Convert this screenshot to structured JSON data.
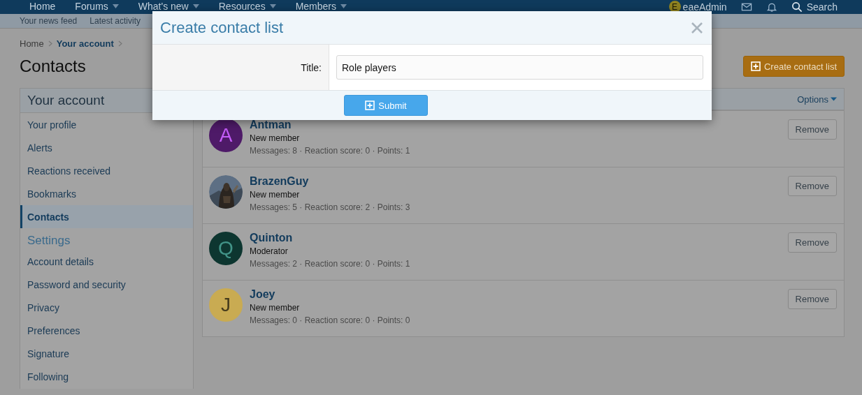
{
  "nav": {
    "items": [
      {
        "label": "Home",
        "dropdown": false
      },
      {
        "label": "Forums",
        "dropdown": true
      },
      {
        "label": "What's new",
        "dropdown": true
      },
      {
        "label": "Resources",
        "dropdown": true
      },
      {
        "label": "Members",
        "dropdown": true
      }
    ],
    "user": {
      "initial": "E",
      "name": "eaeAdmin"
    },
    "search": "Search"
  },
  "subnav": [
    "Your news feed",
    "Latest activity"
  ],
  "breadcrumb": [
    {
      "label": "Home",
      "current": false
    },
    {
      "label": "Your account",
      "current": true
    }
  ],
  "page_title": "Contacts",
  "create_button": "Create contact list",
  "sidebar": {
    "sections": [
      {
        "title": "Your account",
        "items": [
          {
            "label": "Your profile",
            "selected": false
          },
          {
            "label": "Alerts",
            "selected": false
          },
          {
            "label": "Reactions received",
            "selected": false
          },
          {
            "label": "Bookmarks",
            "selected": false
          },
          {
            "label": "Contacts",
            "selected": true
          }
        ]
      },
      {
        "title": "Settings",
        "items": [
          {
            "label": "Account details",
            "selected": false
          },
          {
            "label": "Password and security",
            "selected": false
          },
          {
            "label": "Privacy",
            "selected": false
          },
          {
            "label": "Preferences",
            "selected": false
          },
          {
            "label": "Signature",
            "selected": false
          },
          {
            "label": "Following",
            "selected": false
          }
        ]
      }
    ]
  },
  "options": "Options",
  "contacts": [
    {
      "name": "Antman",
      "title": "New member",
      "stats": "Messages: 8 · Reaction score: 0 · Points: 1",
      "avatar": {
        "kind": "letter",
        "letter": "A",
        "color": "#4e1a68"
      },
      "action": "Remove"
    },
    {
      "name": "BrazenGuy",
      "title": "New member",
      "stats": "Messages: 5 · Reaction score: 2 · Points: 3",
      "action": "Remove"
    },
    {
      "name": "Quinton",
      "title": "Moderator",
      "stats": "Messages: 2 · Reaction score: 0 · Points: 1",
      "avatar": {
        "kind": "letter",
        "letter": "Q",
        "color": "#0d3630"
      },
      "action": "Remove"
    },
    {
      "name": "Joey",
      "title": "New member",
      "stats": "Messages: 0 · Reaction score: 0 · Points: 0",
      "avatar": {
        "kind": "letter",
        "letter": "J",
        "color": "#c9ab52"
      },
      "action": "Remove"
    }
  ],
  "dialog": {
    "title": "Create contact list",
    "fields": [
      {
        "label": "Title:",
        "value": "Role players"
      }
    ],
    "submit": "Submit"
  }
}
